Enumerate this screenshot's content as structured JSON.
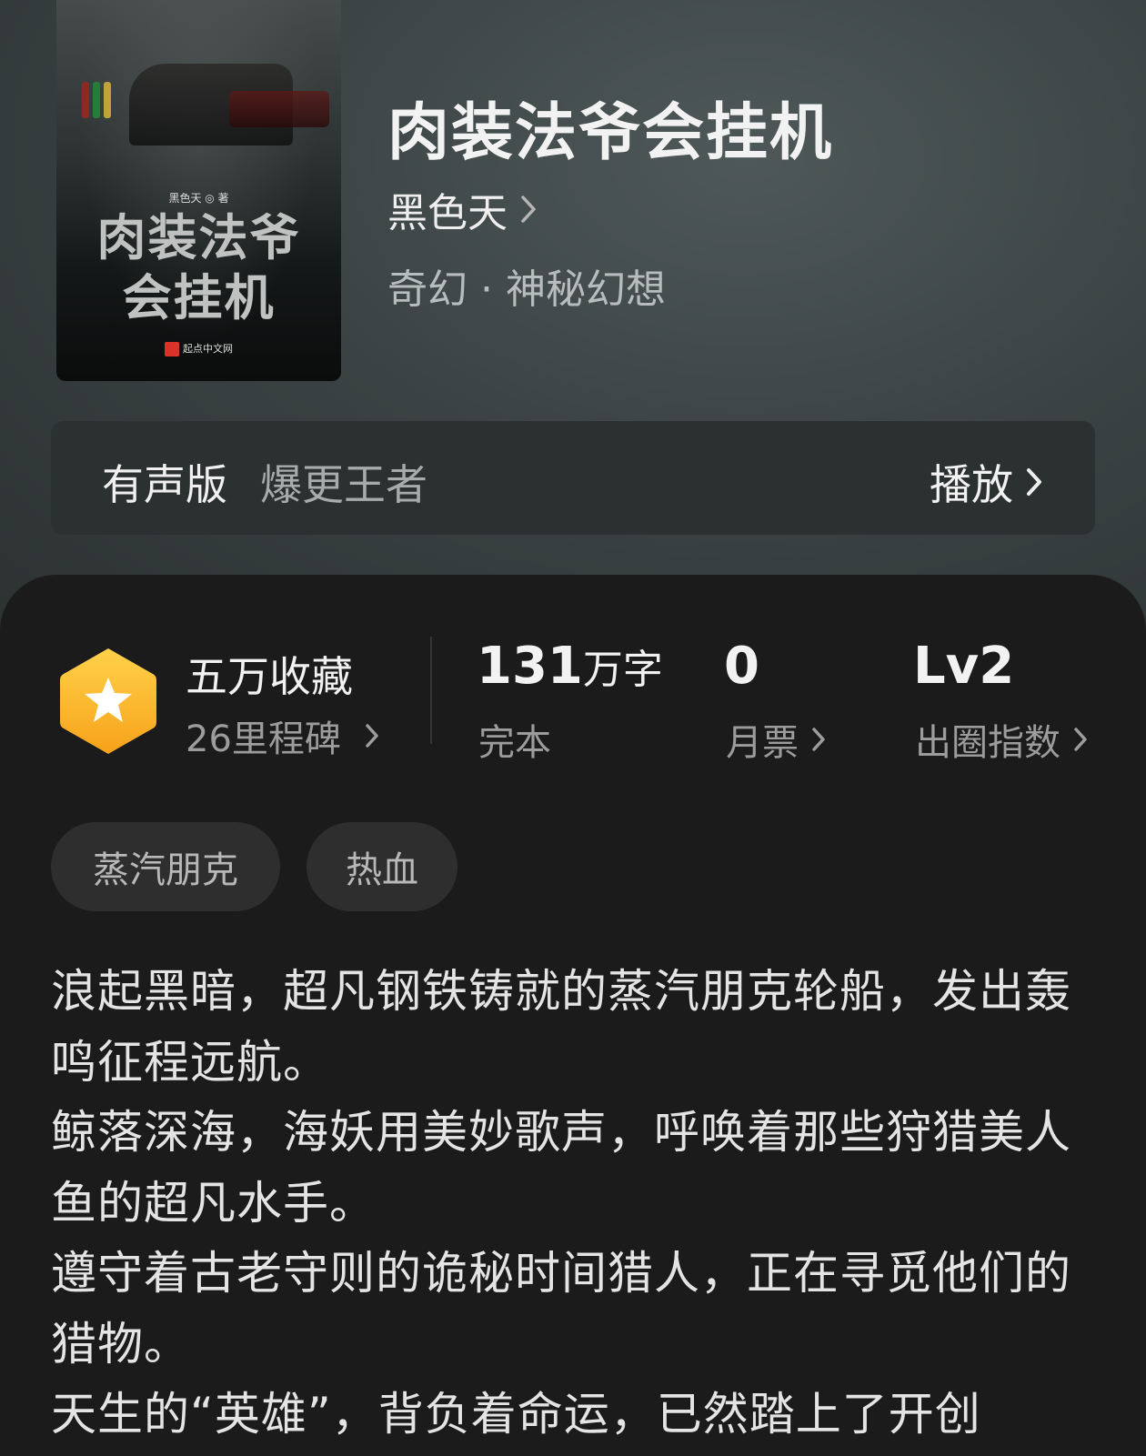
{
  "book": {
    "title": "肉装法爷会挂机",
    "author": "黑色天",
    "genre": "奇幻 · 神秘幻想"
  },
  "cover": {
    "author_line": "黑色天 ◎ 著",
    "title_line1": "肉装法爷",
    "title_line2": "会挂机",
    "publisher": "起点中文网"
  },
  "audio": {
    "label": "有声版",
    "name": "爆更王者",
    "play_label": "播放"
  },
  "stats": {
    "collect_main": "五万收藏",
    "collect_sub": "26里程碑",
    "words_number": "131",
    "words_unit": "万字",
    "words_label": "完本",
    "tickets_value": "0",
    "tickets_label": "月票",
    "level_value": "Lv2",
    "level_label": "出圈指数"
  },
  "tags": [
    "蒸汽朋克",
    "热血"
  ],
  "description": [
    "浪起黑暗，超凡钢铁铸就的蒸汽朋克轮船，发出轰鸣征程远航。",
    "鲸落深海，海妖用美妙歌声，呼唤着那些狩猎美人鱼的超凡水手。",
    "遵守着古老守则的诡秘时间猎人，正在寻觅他们的猎物。",
    "天生的“英雄”，背负着命运，已然踏上了开创"
  ],
  "colors": {
    "badge_top": "#ffd24a",
    "badge_bottom": "#f7a21a",
    "sheet_bg": "#1b1b1c",
    "hero_bg": "#3b4344"
  },
  "icons": {
    "badge": "star-hexagon-icon",
    "chevron": "chevron-right-icon"
  }
}
